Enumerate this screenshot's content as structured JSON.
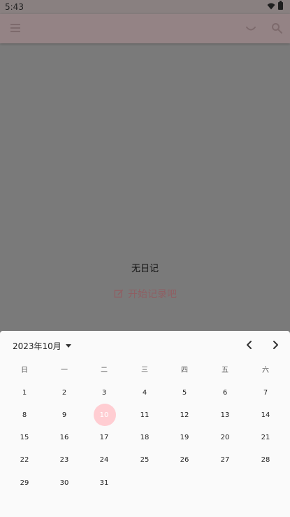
{
  "status_bar": {
    "time": "5:43"
  },
  "app_bar": {
    "icons": [
      "menu-icon",
      "smile-icon",
      "search-icon"
    ]
  },
  "empty_state": {
    "message": "无日记",
    "start_label": "开始记录吧",
    "start_icon": "edit-icon"
  },
  "calendar": {
    "month_label": "2023年10月",
    "weekdays": [
      "日",
      "一",
      "二",
      "三",
      "四",
      "五",
      "六"
    ],
    "weeks": [
      [
        "1",
        "2",
        "3",
        "4",
        "5",
        "6",
        "7"
      ],
      [
        "8",
        "9",
        "10",
        "11",
        "12",
        "13",
        "14"
      ],
      [
        "15",
        "16",
        "17",
        "18",
        "19",
        "20",
        "21"
      ],
      [
        "22",
        "23",
        "24",
        "25",
        "26",
        "27",
        "28"
      ],
      [
        "29",
        "30",
        "31",
        "",
        "",
        "",
        ""
      ]
    ],
    "selected_day": "10",
    "accent_color": "#ffcdd2"
  }
}
